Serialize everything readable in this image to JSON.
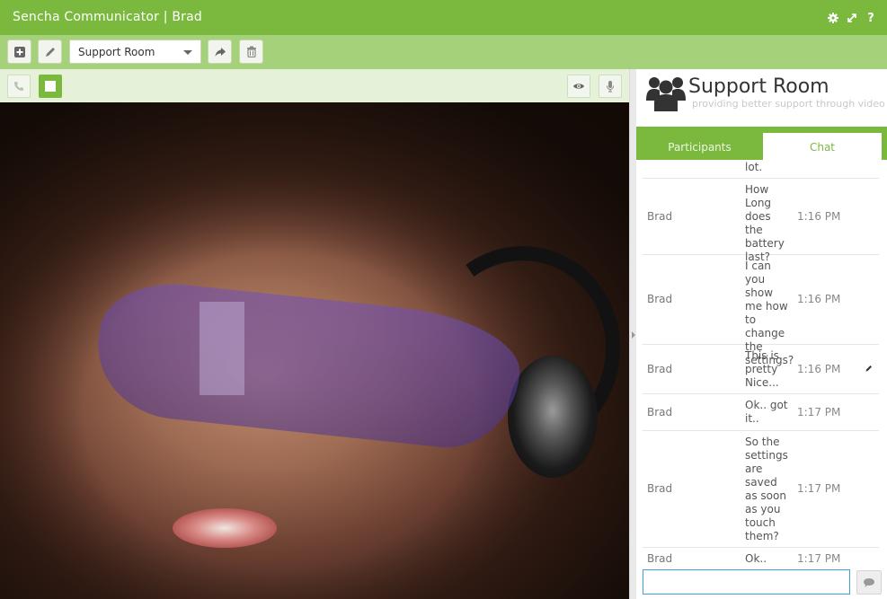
{
  "app": {
    "title": "Sencha Communicator | Brad",
    "icons": [
      "gear-icon",
      "expand-icon",
      "help-icon"
    ]
  },
  "toolbar": {
    "buttons": [
      "new-room-icon",
      "edit-icon",
      "share-icon",
      "delete-icon"
    ],
    "room_select_value": "Support Room"
  },
  "video_controls": {
    "left": [
      "phone-icon",
      "stop-icon"
    ],
    "right": [
      "eye-icon",
      "microphone-icon"
    ]
  },
  "room": {
    "title": "Support Room",
    "subtitle": "providing better support through video"
  },
  "tabs": [
    {
      "label": "Participants",
      "active": false
    },
    {
      "label": "Chat",
      "active": true
    }
  ],
  "chat": {
    "messages": [
      {
        "user": "",
        "text": "lot.",
        "time": ""
      },
      {
        "user": "Brad",
        "text": "How Long does the battery last?",
        "time": "1:16 PM"
      },
      {
        "user": "Brad",
        "text": "I can you show me how to change the settings?",
        "time": "1:16 PM"
      },
      {
        "user": "Brad",
        "text": "This is pretty Nice...",
        "time": "1:16 PM"
      },
      {
        "user": "Brad",
        "text": "Ok.. got it..",
        "time": "1:17 PM"
      },
      {
        "user": "Brad",
        "text": "So the settings are saved as soon as you touch them?",
        "time": "1:17 PM"
      },
      {
        "user": "Brad",
        "text": "Ok..",
        "time": "1:17 PM"
      }
    ],
    "input_value": ""
  },
  "colors": {
    "primary": "#7ab83e",
    "toolbar": "#a6d17b",
    "video_bar": "#e6f1d9",
    "input_focus": "#3fa0d8"
  }
}
